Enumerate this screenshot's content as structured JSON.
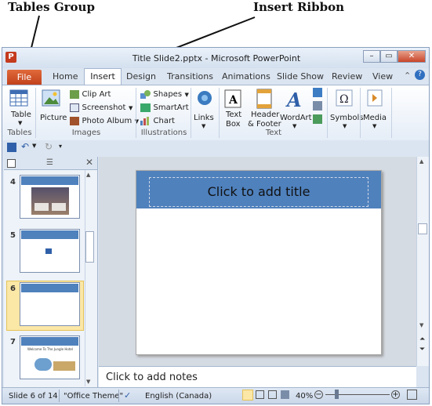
{
  "annotations": {
    "left": "Tables Group",
    "right": "Insert Ribbon"
  },
  "window": {
    "title": "Title Slide2.pptx - Microsoft PowerPoint",
    "app_icon": "P",
    "buttons": {
      "minimize": "–",
      "restore": "▭",
      "close": "✕"
    }
  },
  "tabs": {
    "file": "File",
    "home": "Home",
    "insert": "Insert",
    "design": "Design",
    "transitions": "Transitions",
    "animations": "Animations",
    "slideshow": "Slide Show",
    "review": "Review",
    "view": "View"
  },
  "ribbon": {
    "table": "Table",
    "tables_group": "Tables",
    "picture": "Picture",
    "clipart": "Clip Art",
    "screenshot": "Screenshot",
    "photoalbum": "Photo Album",
    "images_group": "Images",
    "shapes": "Shapes",
    "smartart": "SmartArt",
    "chart": "Chart",
    "illustrations_group": "Illustrations",
    "links": "Links",
    "textbox_1": "Text",
    "textbox_2": "Box",
    "headerfooter_1": "Header",
    "headerfooter_2": "& Footer",
    "wordart": "WordArt",
    "text_group": "Text",
    "symbols": "Symbols",
    "media": "Media"
  },
  "slides_pane": {
    "thumbs": [
      "4",
      "5",
      "6",
      "7"
    ],
    "thumb7_text": "Welcome To The Jungle Hotel"
  },
  "slide": {
    "title_placeholder": "Click to add title"
  },
  "notes": {
    "placeholder": "Click to add notes"
  },
  "status": {
    "slide_info": "Slide 6 of 14",
    "theme": "\"Office Theme\"",
    "language": "English (Canada)",
    "zoom": "40%"
  }
}
